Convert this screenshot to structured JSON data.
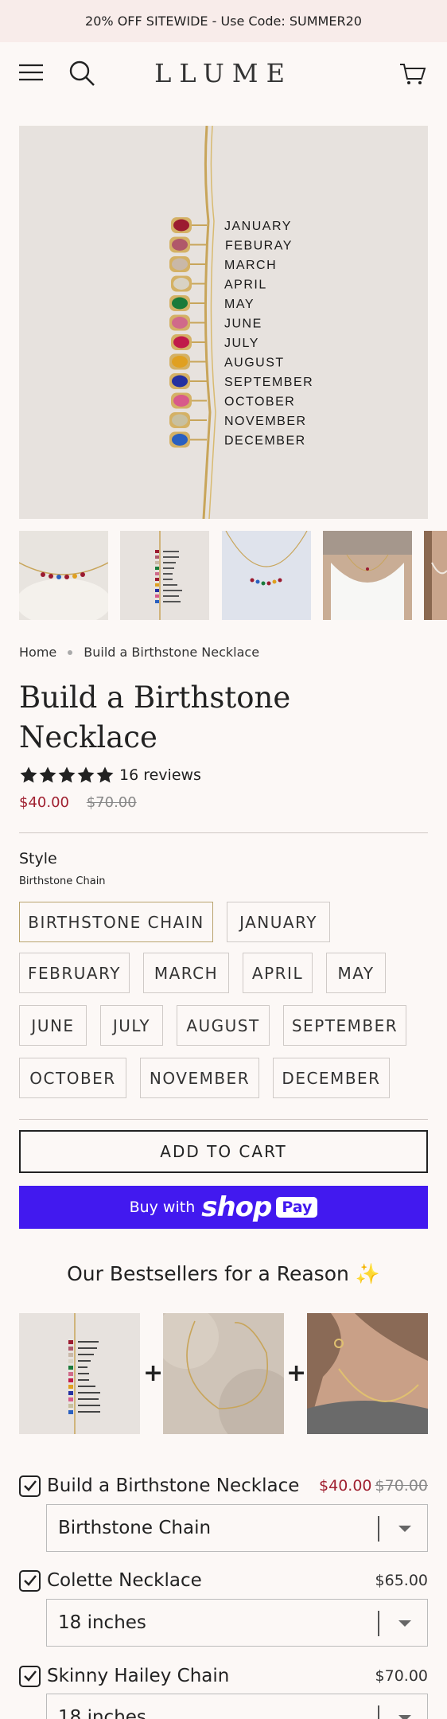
{
  "promo": {
    "text": "20% OFF SITEWIDE - Use Code: SUMMER20"
  },
  "header": {
    "logo": "LLUME"
  },
  "hero": {
    "months": [
      "JANUARY",
      "FEBURAY",
      "MARCH",
      "APRIL",
      "MAY",
      "JUNE",
      "JULY",
      "AUGUST",
      "SEPTEMBER",
      "OCTOBER",
      "NOVEMBER",
      "DECEMBER"
    ],
    "stone_colors": [
      "#9b1b30",
      "#b0586a",
      "#c9b8a8",
      "#d8d2c4",
      "#1a7a3a",
      "#d06a8a",
      "#c01a4a",
      "#e0a020",
      "#2430a0",
      "#d85a8a",
      "#c8c0a0",
      "#2a60c0"
    ]
  },
  "breadcrumb": {
    "home": "Home",
    "current": "Build a Birthstone Necklace"
  },
  "product": {
    "title": "Build a Birthstone Necklace",
    "rating": 5,
    "reviews": "16 reviews",
    "price": "$40.00",
    "compare_price": "$70.00"
  },
  "style": {
    "label": "Style",
    "selected": "Birthstone Chain",
    "options": [
      "BIRTHSTONE CHAIN",
      "JANUARY",
      "FEBRUARY",
      "MARCH",
      "APRIL",
      "MAY",
      "JUNE",
      "JULY",
      "AUGUST",
      "SEPTEMBER",
      "OCTOBER",
      "NOVEMBER",
      "DECEMBER"
    ]
  },
  "actions": {
    "add_to_cart": "ADD TO CART",
    "buy_with": "Buy with",
    "shop": "shop",
    "pay": "Pay"
  },
  "bestsellers": {
    "title": "Our Bestsellers for a Reason ✨",
    "items": [
      {
        "name": "Build a Birthstone Necklace",
        "price": "$40.00",
        "compare_price": "$70.00",
        "variant": "Birthstone Chain",
        "checked": true
      },
      {
        "name": "Colette Necklace",
        "price": "$65.00",
        "variant": "18 inches",
        "checked": true
      },
      {
        "name": "Skinny Hailey Chain",
        "price": "$70.00",
        "variant": "18 inches",
        "checked": true
      }
    ]
  },
  "colors": {
    "accent_red": "#a02030",
    "shop_pay": "#4219ef",
    "selected_border": "#b9a46e"
  }
}
